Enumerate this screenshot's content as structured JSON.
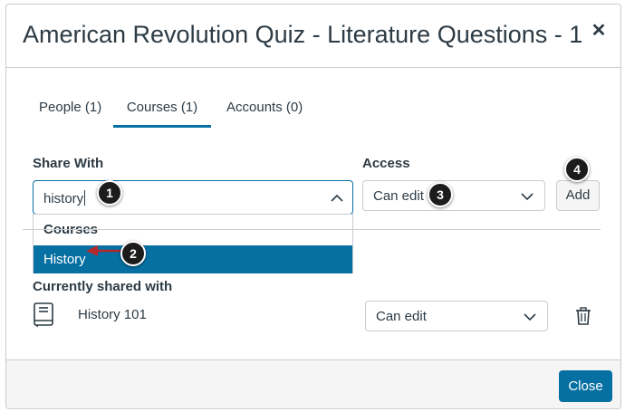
{
  "modal": {
    "title": "American Revolution Quiz - Literature Questions - 1",
    "close_icon": "close-icon"
  },
  "tabs": [
    {
      "label": "People (1)",
      "active": false
    },
    {
      "label": "Courses (1)",
      "active": true
    },
    {
      "label": "Accounts (0)",
      "active": false
    }
  ],
  "share_with": {
    "label": "Share With",
    "value": "history",
    "dropdown": {
      "group": "Courses",
      "options": [
        {
          "label": "History",
          "selected": true
        }
      ]
    }
  },
  "access": {
    "label": "Access",
    "value": "Can edit"
  },
  "add_button": "Add",
  "shared": {
    "label": "Currently shared with",
    "items": [
      {
        "name": "History 101",
        "access": "Can edit",
        "icon": "book-icon"
      }
    ]
  },
  "footer": {
    "close_button": "Close"
  },
  "callouts": [
    "1",
    "2",
    "3",
    "4"
  ],
  "colors": {
    "primary": "#0770a3",
    "text": "#2d3b45",
    "border": "#c7cdd1",
    "callout": "#1c1c1c",
    "arrow": "#b5292b"
  }
}
